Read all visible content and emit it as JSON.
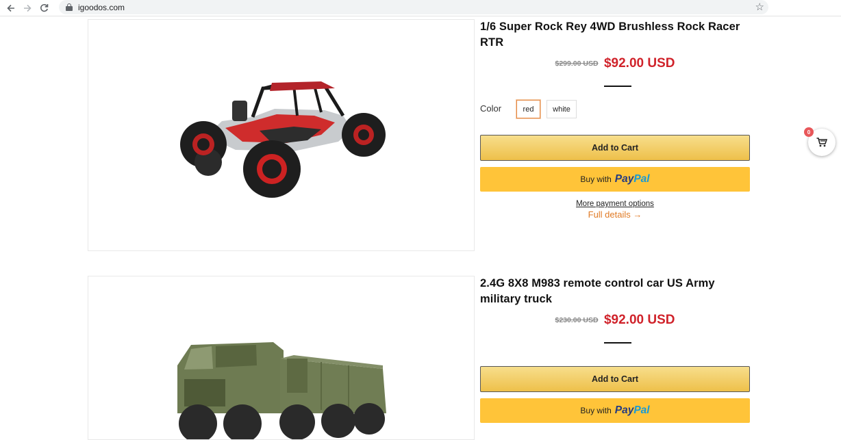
{
  "browser": {
    "url": "igoodos.com",
    "back_icon": "arrow-left-icon",
    "forward_icon": "arrow-right-icon",
    "reload_icon": "reload-icon",
    "bookmark_icon": "star-icon"
  },
  "products": [
    {
      "title": "1/6 Super Rock Rey 4WD Brushless Rock Racer RTR",
      "old_price": "$299.00 USD",
      "price": "$92.00 USD",
      "color_label": "Color",
      "colors": [
        "red",
        "white"
      ],
      "selected_color": "red",
      "add_to_cart": "Add to Cart",
      "paypal_prefix": "Buy with",
      "paypal_brand_1": "Pay",
      "paypal_brand_2": "Pal",
      "more_payment": "More payment options",
      "full_details": "Full details →"
    },
    {
      "title": "2.4G 8X8 M983 remote control car US Army military truck",
      "old_price": "$230.00 USD",
      "price": "$92.00 USD",
      "add_to_cart": "Add to Cart",
      "paypal_prefix": "Buy with",
      "paypal_brand_1": "Pay",
      "paypal_brand_2": "Pal"
    }
  ],
  "cart": {
    "count": "0",
    "icon": "shopping-cart-icon"
  },
  "colors": {
    "sale_price": "#d0222a",
    "accent": "#e07a24",
    "paypal_yellow": "#ffc439",
    "cart_badge": "#e8575a"
  }
}
